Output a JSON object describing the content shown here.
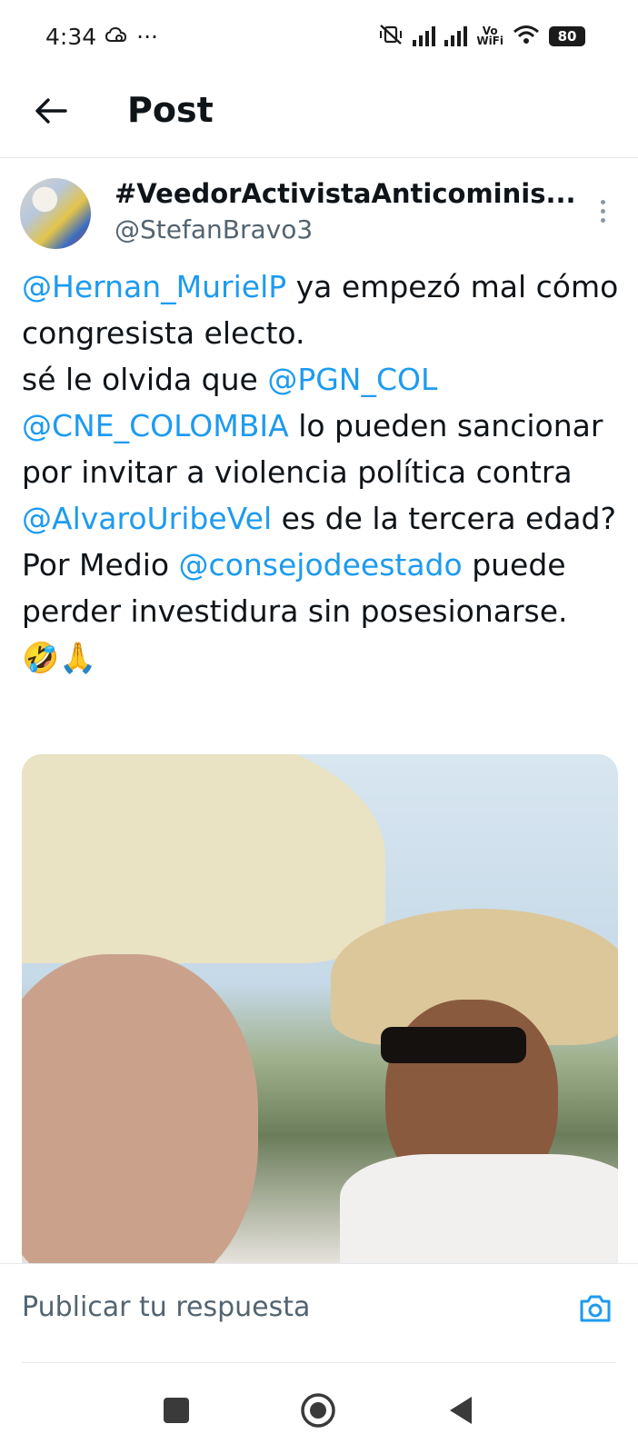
{
  "status_bar": {
    "time": "4:34",
    "dots": "···",
    "vo_line1": "Vo",
    "vo_line2": "WiFi",
    "battery": "80"
  },
  "header": {
    "title": "Post"
  },
  "tweet": {
    "author_name": "#VeedorActivistaAnticominis...",
    "author_handle": "@StefanBravo3",
    "text_segments": {
      "s1": "@Hernan_MurielP",
      "s2": " ya empezó mal cómo congresista electo.",
      "s3": " sé le olvida que ",
      "s4": "@PGN_COL",
      "s5": " ",
      "s6": "@CNE_COLOMBIA",
      "s7": " lo pueden sancionar por invitar a violencia política contra ",
      "s8": "@AlvaroUribeVel",
      "s9": " es de la tercera edad? Por Medio ",
      "s10": "@consejodeestado",
      "s11": " puede perder investidura sin posesionarse.",
      "s12": "🤣🙏"
    }
  },
  "reply": {
    "placeholder": "Publicar tu respuesta"
  },
  "colors": {
    "link": "#1d9bf0",
    "text": "#0f1419",
    "muted": "#536471"
  }
}
